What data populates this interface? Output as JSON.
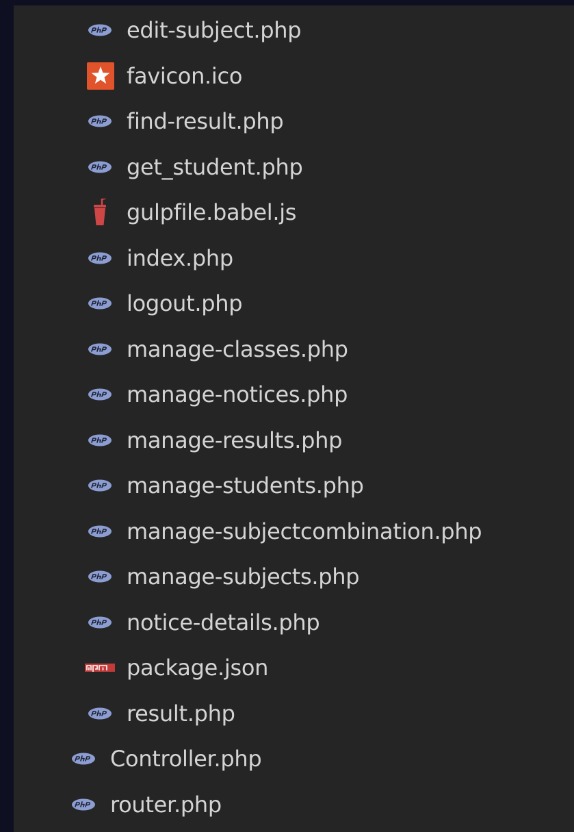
{
  "explorer": {
    "items": [
      {
        "label": "edit-subject.php",
        "icon": "php-icon",
        "depth": 1
      },
      {
        "label": "favicon.ico",
        "icon": "favicon-icon",
        "depth": 1
      },
      {
        "label": "find-result.php",
        "icon": "php-icon",
        "depth": 1
      },
      {
        "label": "get_student.php",
        "icon": "php-icon",
        "depth": 1
      },
      {
        "label": "gulpfile.babel.js",
        "icon": "gulp-icon",
        "depth": 1
      },
      {
        "label": "index.php",
        "icon": "php-icon",
        "depth": 1
      },
      {
        "label": "logout.php",
        "icon": "php-icon",
        "depth": 1
      },
      {
        "label": "manage-classes.php",
        "icon": "php-icon",
        "depth": 1
      },
      {
        "label": "manage-notices.php",
        "icon": "php-icon",
        "depth": 1
      },
      {
        "label": "manage-results.php",
        "icon": "php-icon",
        "depth": 1
      },
      {
        "label": "manage-students.php",
        "icon": "php-icon",
        "depth": 1
      },
      {
        "label": "manage-subjectcombination.php",
        "icon": "php-icon",
        "depth": 1
      },
      {
        "label": "manage-subjects.php",
        "icon": "php-icon",
        "depth": 1
      },
      {
        "label": "notice-details.php",
        "icon": "php-icon",
        "depth": 1
      },
      {
        "label": "package.json",
        "icon": "npm-icon",
        "depth": 1
      },
      {
        "label": "result.php",
        "icon": "php-icon",
        "depth": 1
      },
      {
        "label": "Controller.php",
        "icon": "php-icon",
        "depth": 0
      },
      {
        "label": "router.php",
        "icon": "php-icon",
        "depth": 0
      }
    ]
  },
  "colors": {
    "outer_background": "#0f0f22",
    "panel_background": "#252526",
    "text": "#d4d4d4",
    "php_icon": "#8c9ed1",
    "favicon_icon": "#e0532b",
    "gulp_icon": "#cf4646",
    "npm_icon": "#c23b3b"
  }
}
